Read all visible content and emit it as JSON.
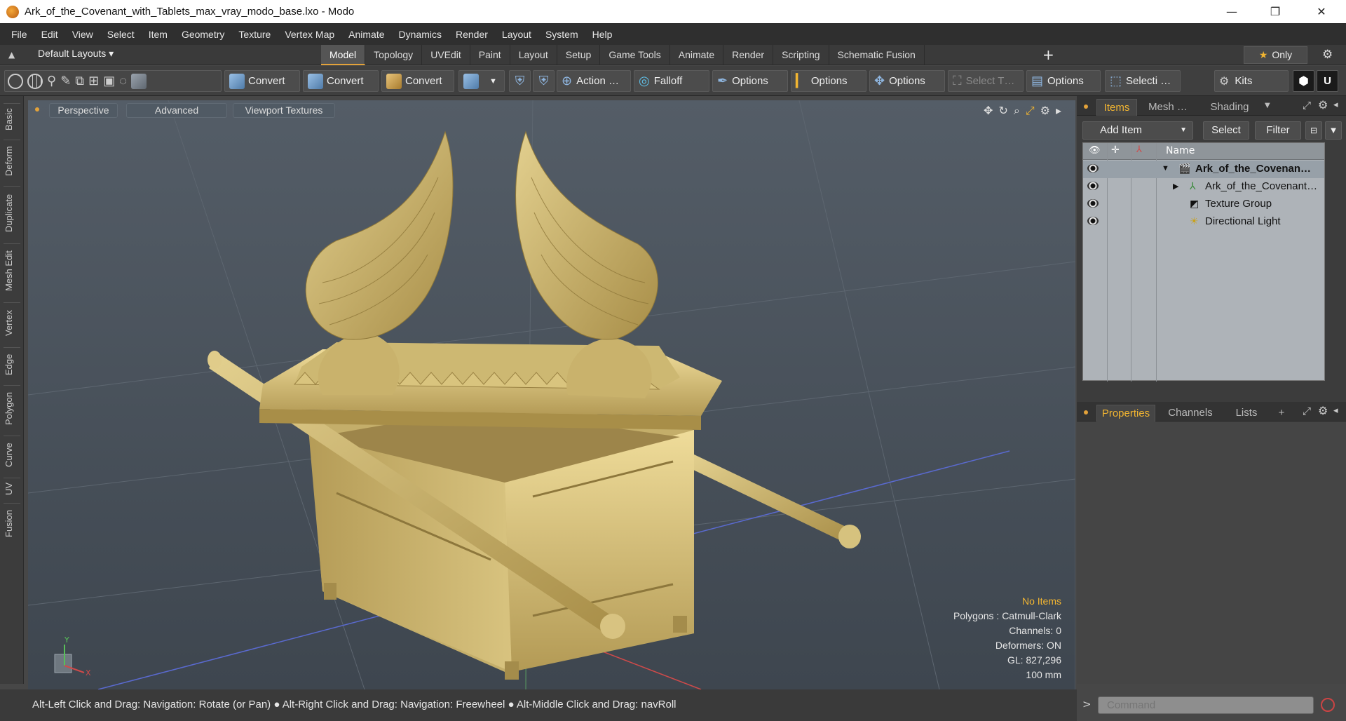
{
  "window": {
    "title": "Ark_of_the_Covenant_with_Tablets_max_vray_modo_base.lxo - Modo",
    "minimize": "—",
    "maximize": "❐",
    "close": "✕"
  },
  "menu": [
    "File",
    "Edit",
    "View",
    "Select",
    "Item",
    "Geometry",
    "Texture",
    "Vertex Map",
    "Animate",
    "Dynamics",
    "Render",
    "Layout",
    "System",
    "Help"
  ],
  "layout_selector": "Default Layouts ▾",
  "tabs": [
    {
      "label": "Model",
      "active": true
    },
    {
      "label": "Topology"
    },
    {
      "label": "UVEdit"
    },
    {
      "label": "Paint"
    },
    {
      "label": "Layout"
    },
    {
      "label": "Setup"
    },
    {
      "label": "Game Tools"
    },
    {
      "label": "Animate"
    },
    {
      "label": "Render"
    },
    {
      "label": "Scripting"
    },
    {
      "label": "Schematic Fusion"
    }
  ],
  "tab_add": "+",
  "only_button": "Only",
  "toolbar": {
    "convert1": "Convert",
    "convert2": "Convert",
    "convert3": "Convert",
    "action": "Action …",
    "falloff": "Falloff",
    "options1": "Options",
    "options2": "Options",
    "options3": "Options",
    "select_t": "Select T…",
    "options4": "Options",
    "selecti": "Selecti …",
    "kits": "Kits"
  },
  "left_tabs": [
    "Basic",
    "Deform",
    "Duplicate",
    "Mesh Edit",
    "Vertex",
    "Edge",
    "Polygon",
    "Curve",
    "UV",
    "Fusion"
  ],
  "viewport": {
    "perspective": "Perspective",
    "advanced": "Advanced",
    "textures": "Viewport Textures",
    "hud": {
      "no_items": "No Items",
      "polygons": "Polygons : Catmull-Clark",
      "channels": "Channels: 0",
      "deformers": "Deformers: ON",
      "gl": "GL: 827,296",
      "scale": "100 mm"
    }
  },
  "items_panel": {
    "tabs": [
      "Items",
      "Mesh …",
      "Shading"
    ],
    "add_item": "Add Item",
    "select": "Select",
    "filter": "Filter",
    "name_header": "Name",
    "rows": [
      {
        "label": "Ark_of_the_Covenan…",
        "bold": true
      },
      {
        "label": "Ark_of_the_Covenant…"
      },
      {
        "label": "Texture Group"
      },
      {
        "label": "Directional Light"
      }
    ]
  },
  "properties_panel": {
    "tabs": [
      "Properties",
      "Channels",
      "Lists"
    ],
    "add": "+"
  },
  "status": "Alt-Left Click and Drag: Navigation: Rotate (or Pan) ● Alt-Right Click and Drag: Navigation: Freewheel ● Alt-Middle Click and Drag: navRoll",
  "command_placeholder": "Command",
  "colors": {
    "accent": "#f2b531",
    "gold": "#c9b06a"
  }
}
